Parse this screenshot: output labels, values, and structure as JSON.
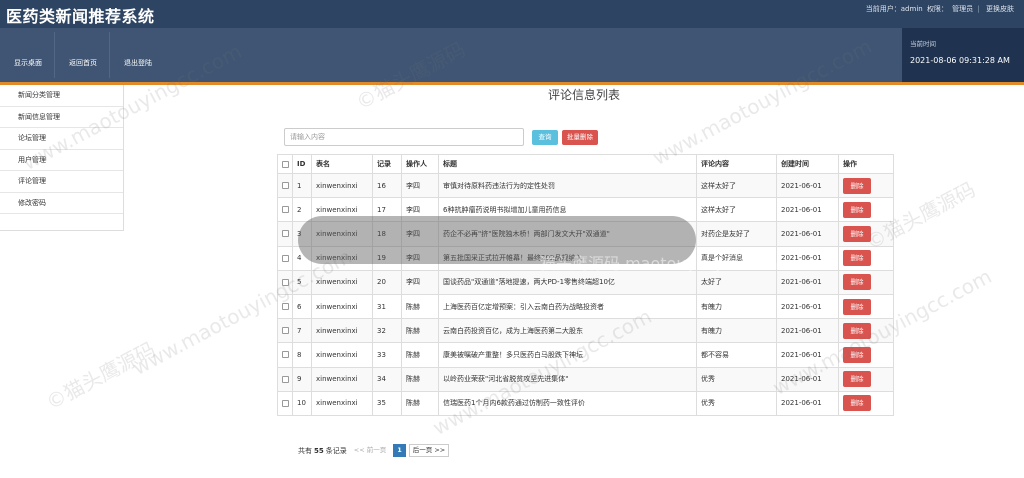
{
  "app": {
    "title": "医药类新闻推荐系统"
  },
  "user": {
    "current_user_label": "当前用户：admin",
    "role_label": "权限：",
    "role": "管理员",
    "skin": "更换皮肤"
  },
  "nav": {
    "items": [
      "显示桌面",
      "返回首页",
      "退出登陆"
    ]
  },
  "clock": {
    "label": "当前时间",
    "value": "2021-08-06 09:31:28 AM"
  },
  "sidebar": {
    "items": [
      "新闻分类管理",
      "新闻信息管理",
      "论坛管理",
      "用户管理",
      "评论管理",
      "修改密码"
    ]
  },
  "page": {
    "heading": "评论信息列表"
  },
  "search": {
    "placeholder": "请输入内容",
    "query_button": "查询",
    "batch_delete_button": "批量删除"
  },
  "table": {
    "columns": [
      "",
      "ID",
      "表名",
      "记录",
      "操作人",
      "标题",
      "评论内容",
      "创建时间",
      "操作"
    ],
    "delete_label": "删除",
    "rows": [
      {
        "id": "1",
        "table": "xinwenxinxi",
        "record": "16",
        "operator": "李四",
        "title": "审慎对待原料药违法行为的定性处罚",
        "comment": "这样太好了",
        "created": "2021-06-01"
      },
      {
        "id": "2",
        "table": "xinwenxinxi",
        "record": "17",
        "operator": "李四",
        "title": "6种抗肿瘤药说明书拟增加儿童用药信息",
        "comment": "这样太好了",
        "created": "2021-06-01"
      },
      {
        "id": "3",
        "table": "xinwenxinxi",
        "record": "18",
        "operator": "李四",
        "title": "药企不必再\"挤\"医院独木桥！两部门发文大开\"双通道\"",
        "comment": "对药企是友好了",
        "created": "2021-06-01"
      },
      {
        "id": "4",
        "table": "xinwenxinxi",
        "record": "19",
        "operator": "李四",
        "title": "第五批国采正式拉开帷幕！最终202品规纳入",
        "comment": "真是个好消息",
        "created": "2021-06-01"
      },
      {
        "id": "5",
        "table": "xinwenxinxi",
        "record": "20",
        "operator": "李四",
        "title": "国谈药品\"双通道\"落地提速，两大PD-1零售终端超10亿",
        "comment": "太好了",
        "created": "2021-06-01"
      },
      {
        "id": "6",
        "table": "xinwenxinxi",
        "record": "31",
        "operator": "陈赫",
        "title": "上海医药百亿定增预案：引入云南白药为战略投资者",
        "comment": "有魄力",
        "created": "2021-06-01"
      },
      {
        "id": "7",
        "table": "xinwenxinxi",
        "record": "32",
        "operator": "陈赫",
        "title": "云南白药投资百亿，成为上海医药第二大股东",
        "comment": "有魄力",
        "created": "2021-06-01"
      },
      {
        "id": "8",
        "table": "xinwenxinxi",
        "record": "33",
        "operator": "陈赫",
        "title": "康美被嘱破产重整！多只医药白马股跌下神坛",
        "comment": "都不容易",
        "created": "2021-06-01"
      },
      {
        "id": "9",
        "table": "xinwenxinxi",
        "record": "34",
        "operator": "陈赫",
        "title": "以岭药业荣获\"河北省脱贫攻坚先进集体\"",
        "comment": "优秀",
        "created": "2021-06-01"
      },
      {
        "id": "10",
        "table": "xinwenxinxi",
        "record": "35",
        "operator": "陈赫",
        "title": "信瑞医药1个月内6款药通过仿制药一致性评价",
        "comment": "优秀",
        "created": "2021-06-01"
      }
    ]
  },
  "pagination": {
    "prefix": "共有",
    "total": "55",
    "suffix": "条记录",
    "prev": "<< 前一页",
    "current": "1",
    "next": "后一页 >>"
  },
  "watermark": {
    "text": "www.maotouyingcc.com",
    "brand": "©猫头鹰源码",
    "overlay": "猫头鹰源码 maotouyingcc.com"
  }
}
